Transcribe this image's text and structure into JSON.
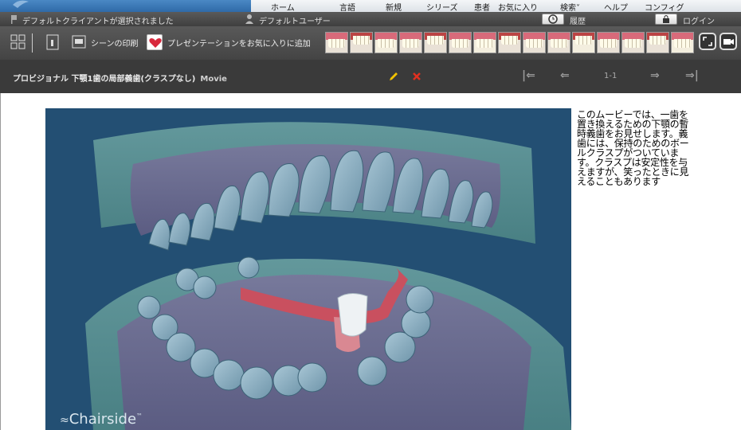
{
  "menu": {
    "items": [
      "ホーム",
      "言語",
      "新規",
      "シリーズ",
      "患者",
      "お気に入り",
      "検索",
      "ヘルプ",
      "コンフィグ"
    ]
  },
  "status": {
    "client_text": "デフォルトクライアントが選択されました",
    "user_text": "デフォルトユーザー",
    "history_label": "履歴",
    "login_label": "ログイン"
  },
  "toolbar": {
    "print_scene_label": "シーンの印刷",
    "add_favorite_label": "プレゼンテーションをお気に入りに追加",
    "thumbnail_count": 15
  },
  "presentation": {
    "title": "プロビジョナル 下顎1歯の局部義歯(クラスプなし)",
    "tag": "Movie",
    "page_indicator": "1-1"
  },
  "video": {
    "watermark": "Chairside",
    "trademark": "™"
  },
  "description": "このムービーでは、一歯を置き換えるための下顎の暫時義歯をお見せします。義歯には、保持のためのボールクラスプがついています。クラスプは安定性を与えますが、笑ったときに見えることもあります",
  "colors": {
    "accent_blue": "#2f6aa8",
    "edit_pencil": "#f2c200",
    "delete_x": "#e03020",
    "video_bg": "#234f73",
    "favorite_heart": "#d8283c"
  }
}
